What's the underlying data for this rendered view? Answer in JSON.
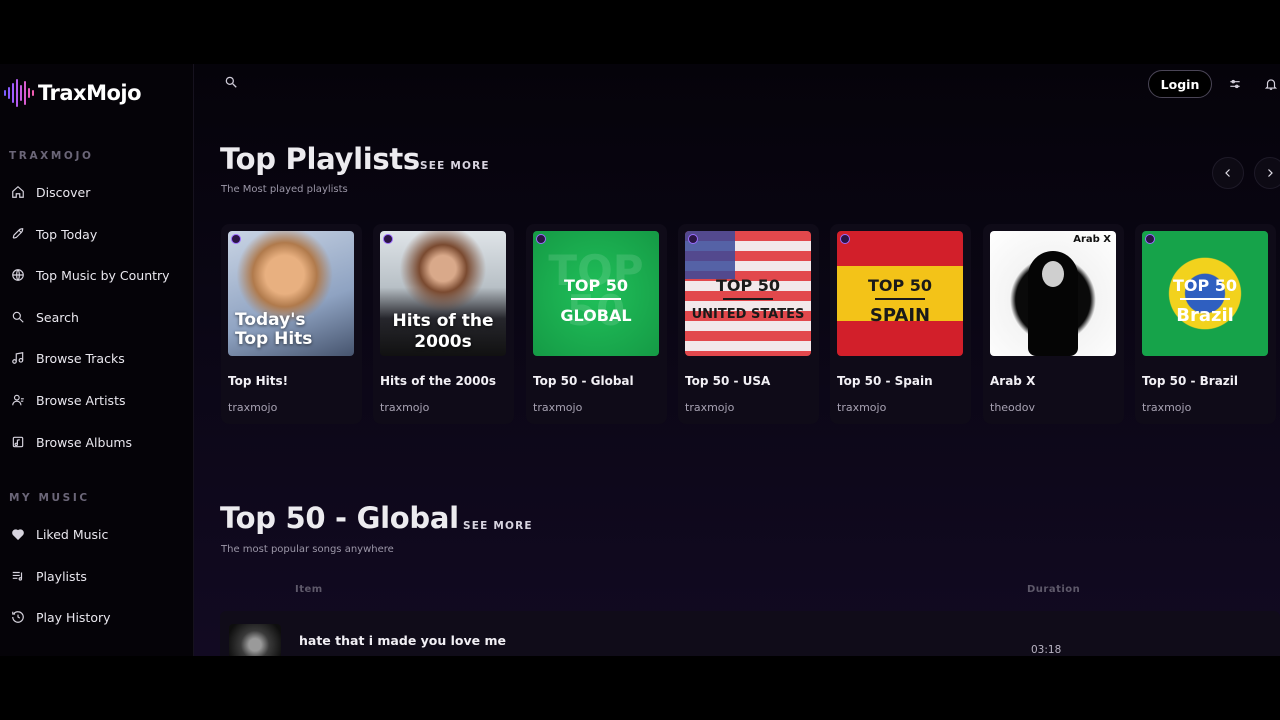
{
  "brand": {
    "name": "TraxMojo"
  },
  "sidebar": {
    "section_main": "TRAXMOJO",
    "items": [
      {
        "label": "Discover",
        "icon": "home-icon"
      },
      {
        "label": "Top Today",
        "icon": "rocket-icon"
      },
      {
        "label": "Top Music by Country",
        "icon": "globe-icon"
      },
      {
        "label": "Search",
        "icon": "search-icon"
      },
      {
        "label": "Browse Tracks",
        "icon": "music-note-icon"
      },
      {
        "label": "Browse Artists",
        "icon": "user-icon"
      },
      {
        "label": "Browse Albums",
        "icon": "album-icon"
      }
    ],
    "section_mine": "MY MUSIC",
    "my_items": [
      {
        "label": "Liked Music",
        "icon": "heart-icon"
      },
      {
        "label": "Playlists",
        "icon": "playlist-icon"
      },
      {
        "label": "Play History",
        "icon": "history-icon"
      }
    ]
  },
  "topbar": {
    "login_label": "Login"
  },
  "top_playlists": {
    "title": "Top Playlists",
    "see_more": "SEE MORE",
    "subtitle": "The Most played playlists",
    "cards": [
      {
        "title": "Top Hits!",
        "author": "traxmojo",
        "cover_line1": "Today's",
        "cover_line2": "Top Hits"
      },
      {
        "title": "Hits of the 2000s",
        "author": "traxmojo",
        "cover_line1": "Hits of the",
        "cover_line2": "2000s"
      },
      {
        "title": "Top 50 - Global",
        "author": "traxmojo",
        "cover_line1": "TOP 50",
        "cover_line2": "GLOBAL"
      },
      {
        "title": "Top 50 - USA",
        "author": "traxmojo",
        "cover_line1": "TOP 50",
        "cover_line2": "UNITED STATES"
      },
      {
        "title": "Top 50 - Spain",
        "author": "traxmojo",
        "cover_line1": "TOP 50",
        "cover_line2": "SPAIN"
      },
      {
        "title": "Arab X",
        "author": "theodov",
        "cover_line1": "Arab X"
      },
      {
        "title": "Top 50 - Brazil",
        "author": "traxmojo",
        "cover_line1": "TOP 50",
        "cover_line2": "Brazil"
      }
    ]
  },
  "top50_global": {
    "title": "Top 50 - Global",
    "see_more": "SEE MORE",
    "subtitle": "The most popular songs anywhere",
    "columns": {
      "item": "Item",
      "duration": "Duration"
    },
    "rows": [
      {
        "title": "hate that i made you love me",
        "duration": "03:18"
      }
    ]
  },
  "colors": {
    "accent": "#9b6bff",
    "background": "#0a0614"
  }
}
